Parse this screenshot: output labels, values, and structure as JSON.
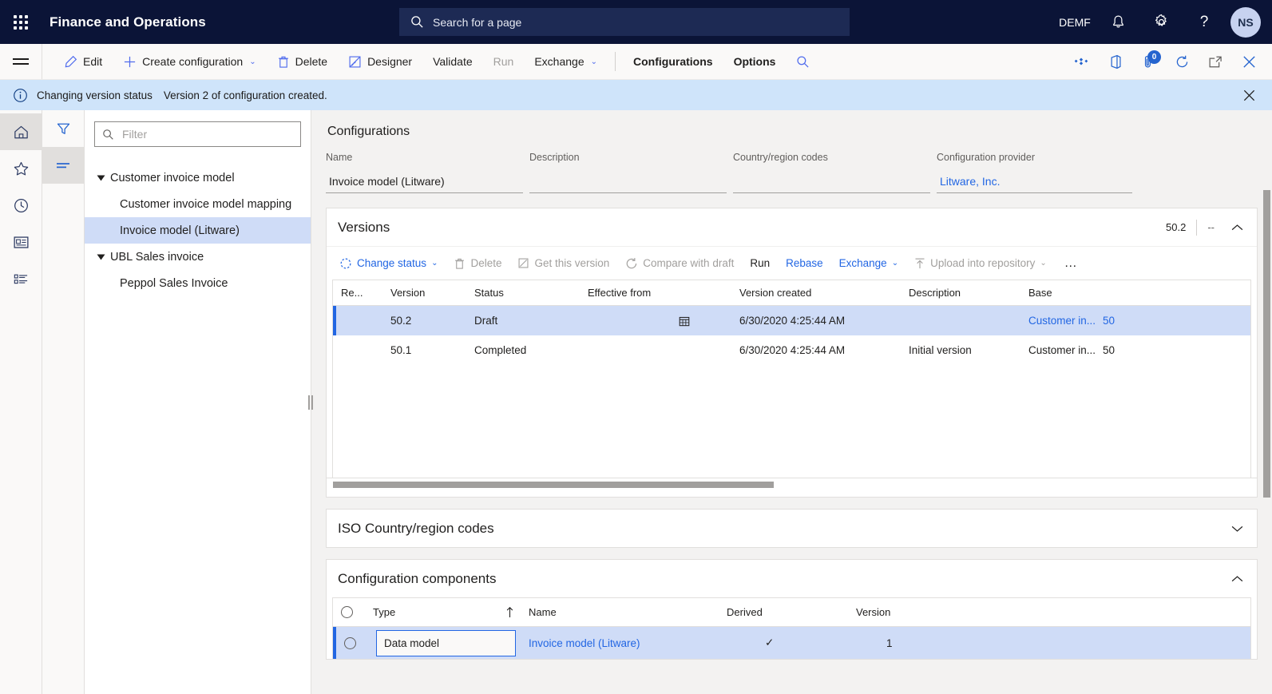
{
  "topbar": {
    "waffle_label": "app-launcher",
    "app_title": "Finance and Operations",
    "search_placeholder": "Search for a page",
    "company": "DEMF",
    "notifications_icon": "bell-icon",
    "settings_icon": "gear-icon",
    "help_icon": "question-mark-icon",
    "avatar_initials": "NS"
  },
  "commandbar": {
    "edit": "Edit",
    "create_configuration": "Create configuration",
    "delete": "Delete",
    "designer": "Designer",
    "validate": "Validate",
    "run": "Run",
    "exchange": "Exchange",
    "configurations": "Configurations",
    "options": "Options",
    "search_icon": "search-icon",
    "right_icons": {
      "relationships": "relationships-icon",
      "office": "office-icon",
      "attachments": "attachment-icon",
      "attachments_count": "0",
      "refresh": "refresh-icon",
      "popout": "open-in-new-window-icon",
      "close": "close-icon"
    }
  },
  "messagebar": {
    "icon": "info-icon",
    "title": "Changing version status",
    "text": "Version 2 of configuration created.",
    "close_icon": "close-icon"
  },
  "rail": {
    "items": [
      {
        "name": "home",
        "icon": "home-icon"
      },
      {
        "name": "favorites",
        "icon": "star-icon"
      },
      {
        "name": "recent",
        "icon": "clock-icon"
      },
      {
        "name": "workspaces",
        "icon": "workspace-icon"
      },
      {
        "name": "modules",
        "icon": "modules-list-icon"
      }
    ]
  },
  "treepane": {
    "tools": [
      {
        "name": "filter",
        "icon": "funnel-icon",
        "active": false
      },
      {
        "name": "list",
        "icon": "lines-icon",
        "active": true
      }
    ],
    "filter_placeholder": "Filter",
    "filter_value": "",
    "filter_icon": "search-icon",
    "items": [
      {
        "label": "Customer invoice model",
        "level": 0,
        "expandable": true,
        "selected": false
      },
      {
        "label": "Customer invoice model mapping",
        "level": 1,
        "expandable": false,
        "selected": false
      },
      {
        "label": "Invoice model (Litware)",
        "level": 1,
        "expandable": false,
        "selected": true
      },
      {
        "label": "UBL Sales invoice",
        "level": 0,
        "expandable": true,
        "selected": false
      },
      {
        "label": "Peppol Sales Invoice",
        "level": 1,
        "expandable": false,
        "selected": false
      }
    ]
  },
  "header": {
    "section_title": "Configurations",
    "fields": [
      {
        "label": "Name",
        "value": "Invoice model (Litware)",
        "link": false
      },
      {
        "label": "Description",
        "value": "",
        "link": false
      },
      {
        "label": "Country/region codes",
        "value": "",
        "link": false
      },
      {
        "label": "Configuration provider",
        "value": "Litware, Inc.",
        "link": true
      }
    ]
  },
  "versions": {
    "title": "Versions",
    "summary_version": "50.2",
    "summary_dash": "--",
    "collapse_icon": "chevron-up-icon",
    "toolbar": [
      {
        "label": "Change status",
        "style": "link",
        "icon": "status-circle-icon",
        "dropdown": true
      },
      {
        "label": "Delete",
        "style": "dim",
        "icon": "trash-icon",
        "dropdown": false
      },
      {
        "label": "Get this version",
        "style": "dim",
        "icon": "edit-box-icon",
        "dropdown": false
      },
      {
        "label": "Compare with draft",
        "style": "dim",
        "icon": "compare-icon",
        "dropdown": false
      },
      {
        "label": "Run",
        "style": "plain",
        "icon": "",
        "dropdown": false
      },
      {
        "label": "Rebase",
        "style": "link",
        "icon": "",
        "dropdown": false
      },
      {
        "label": "Exchange",
        "style": "link",
        "icon": "",
        "dropdown": true
      },
      {
        "label": "Upload into repository",
        "style": "dim",
        "icon": "upload-icon",
        "dropdown": true
      },
      {
        "label": "…",
        "style": "dots",
        "icon": "",
        "dropdown": false
      }
    ],
    "columns": [
      "Re...",
      "Version",
      "Status",
      "Effective from",
      "Version created",
      "Description",
      "Base",
      ""
    ],
    "rows": [
      {
        "selected": true,
        "re": "",
        "version": "50.2",
        "status": "Draft",
        "effective_from": "",
        "effective_from_icon": "calendar-icon",
        "version_created": "6/30/2020 4:25:44 AM",
        "description": "",
        "base": "Customer in...",
        "base_num": "50"
      },
      {
        "selected": false,
        "re": "",
        "version": "50.1",
        "status": "Completed",
        "effective_from": "",
        "effective_from_icon": "",
        "version_created": "6/30/2020 4:25:44 AM",
        "description": "Initial version",
        "base": "Customer in...",
        "base_num": "50"
      }
    ]
  },
  "iso_section": {
    "title": "ISO Country/region codes",
    "expand_icon": "chevron-down-icon"
  },
  "components": {
    "title": "Configuration components",
    "collapse_icon": "chevron-up-icon",
    "columns": [
      "",
      "Type",
      "Name",
      "Derived",
      "Version"
    ],
    "sort_icon": "sort-ascending-arrow-icon",
    "rows": [
      {
        "selected": true,
        "type": "Data model",
        "name": "Invoice model (Litware)",
        "derived": "✓",
        "version": "1",
        "select_icon": "radio-circle-icon"
      }
    ]
  },
  "colors": {
    "nav_bg": "#0b1437",
    "accent_link": "#2266e3",
    "selection_row": "#cfdcf7",
    "selection_bar": "#2266e3",
    "message_bar": "#cfe4fa",
    "page_bg": "#f3f2f1"
  }
}
